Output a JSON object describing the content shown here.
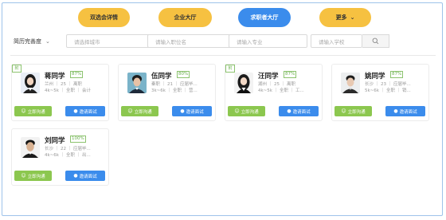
{
  "nav": {
    "tabs": [
      {
        "label": "双选会详情"
      },
      {
        "label": "企业大厅"
      },
      {
        "label": "求职者大厅"
      },
      {
        "label": "更多"
      }
    ]
  },
  "filters": {
    "sort_label": "简历完善度",
    "city_placeholder": "请选择城市",
    "position_placeholder": "请输入职位名",
    "major_placeholder": "请输入专业",
    "school_placeholder": "请输入学校"
  },
  "card_buttons": {
    "chat_label": "立即沟通",
    "invite_label": "邀请面试"
  },
  "candidates": [
    {
      "tag": "附",
      "name": "蒋同学",
      "completeness": "87%",
      "meta1": "兰州 ｜ 25 ｜ 离职",
      "meta2": "4k~5k ｜ 全职 ｜ 会计"
    },
    {
      "tag": "",
      "name": "伍同学",
      "completeness": "80%",
      "meta1": "秦职 ｜ 21 ｜ 应届毕...",
      "meta2": "3k~6k ｜ 全职 ｜ 营..."
    },
    {
      "tag": "附",
      "name": "汪同学",
      "completeness": "87%",
      "meta1": "湖州 ｜ 25 ｜ 离职",
      "meta2": "4k~5k ｜ 全职 ｜ 工..."
    },
    {
      "tag": "",
      "name": "姚同学",
      "completeness": "87%",
      "meta1": "长沙 ｜ 23 ｜ 应届毕...",
      "meta2": "5k~6k ｜ 全职 ｜ 销..."
    },
    {
      "tag": "",
      "name": "刘同学",
      "completeness": "100%",
      "meta1": "长沙 ｜ 22 ｜ 应届毕...",
      "meta2": "4k~6k ｜ 全职 ｜ 出..."
    }
  ]
}
